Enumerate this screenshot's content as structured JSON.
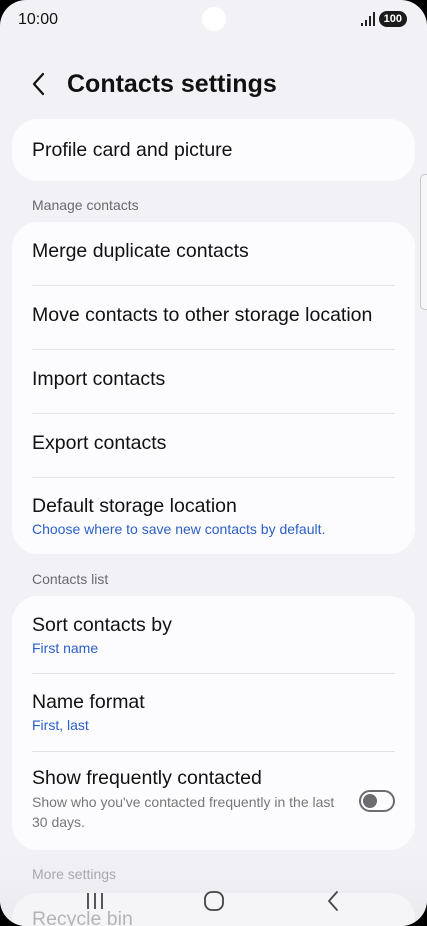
{
  "status_bar": {
    "time": "10:00",
    "battery": "100",
    "icons": [
      "camera-icon",
      "signal-icon",
      "battery-icon"
    ]
  },
  "header": {
    "back_icon": "chevron-left-icon",
    "title": "Contacts settings"
  },
  "profile_card": {
    "title": "Profile card and picture"
  },
  "manage_contacts": {
    "label": "Manage contacts",
    "items": [
      {
        "title": "Merge duplicate contacts"
      },
      {
        "title": "Move contacts to other storage location"
      },
      {
        "title": "Import contacts"
      },
      {
        "title": "Export contacts"
      },
      {
        "title": "Default storage location",
        "subtitle": "Choose where to save new contacts by default."
      }
    ]
  },
  "contacts_list": {
    "label": "Contacts list",
    "items": [
      {
        "title": "Sort contacts by",
        "value": "First name"
      },
      {
        "title": "Name format",
        "value": "First, last"
      },
      {
        "title": "Show frequently contacted",
        "description": "Show who you've contacted frequently in the last 30 days.",
        "toggle_on": false
      }
    ]
  },
  "more_settings": {
    "label": "More settings",
    "items": [
      {
        "title": "Recycle bin"
      }
    ]
  },
  "nav_bar": {
    "icons": [
      "recent-apps-icon",
      "home-icon",
      "back-icon"
    ]
  },
  "colors": {
    "background": "#f2f2f6",
    "card": "#fcfcfe",
    "accent_blue": "#2a5fc7"
  }
}
